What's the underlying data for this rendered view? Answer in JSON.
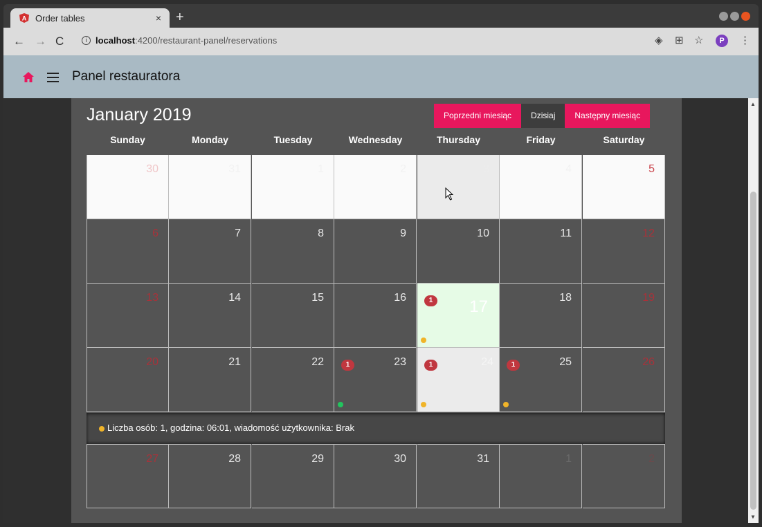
{
  "browser": {
    "tab_title": "Order tables",
    "tab_close": "×",
    "new_tab": "+",
    "url_host": "localhost",
    "url_path": ":4200/restaurant-panel/reservations",
    "info": "i",
    "avatar_letter": "P"
  },
  "app": {
    "title": "Panel restauratora"
  },
  "calendar": {
    "month_title": "January 2019",
    "buttons": {
      "prev": "Poprzedni miesiąc",
      "today": "Dzisiaj",
      "next": "Następny miesiąc"
    },
    "weekdays": [
      "Sunday",
      "Monday",
      "Tuesday",
      "Wednesday",
      "Thursday",
      "Friday",
      "Saturday"
    ],
    "weeks": [
      [
        "30",
        "31",
        "1",
        "2",
        "3",
        "4",
        "5"
      ],
      [
        "6",
        "7",
        "8",
        "9",
        "10",
        "11",
        "12"
      ],
      [
        "13",
        "14",
        "15",
        "16",
        "17",
        "18",
        "19"
      ],
      [
        "20",
        "21",
        "22",
        "23",
        "24",
        "25",
        "26"
      ],
      [
        "27",
        "28",
        "29",
        "30",
        "31",
        "1",
        "2"
      ]
    ],
    "badges": {
      "17": "1",
      "23": "1",
      "24": "1",
      "25": "1"
    },
    "event_detail": "Liczba osób: 1, godzina: 06:01, wiadomość użytkownika: Brak"
  },
  "colors": {
    "accent": "#e8175d",
    "toolbar": "#a9bac4",
    "badge": "#c0373f",
    "dot_yellow": "#f0b429",
    "dot_green": "#22c55e",
    "today_bg": "#e6fbe6",
    "weekend_text": "#a8323a"
  },
  "icons": [
    "angular-icon",
    "home-icon",
    "menu-icon",
    "location-icon",
    "translate-icon",
    "star-icon",
    "kebab-icon",
    "cursor-icon"
  ]
}
